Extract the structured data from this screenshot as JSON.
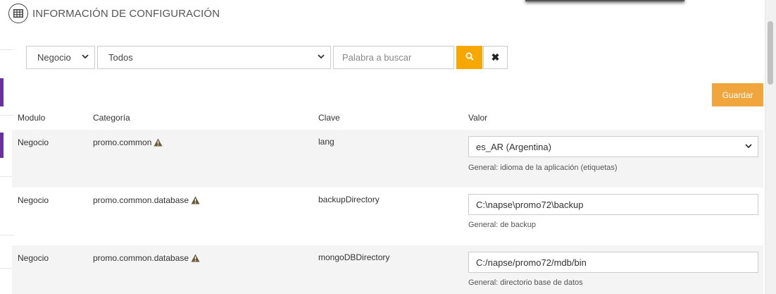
{
  "header": {
    "title": "INFORMACIÓN DE CONFIGURACIÓN",
    "icon": "table-icon"
  },
  "filters": {
    "module_select": {
      "value": "Negocio"
    },
    "category_select": {
      "value": "Todos"
    },
    "search": {
      "placeholder": "Palabra a buscar",
      "value": ""
    },
    "search_icon": "search-icon",
    "clear_label": "✖"
  },
  "toolbar": {
    "save_label": "Guardar"
  },
  "colors": {
    "accent": "#f6a800",
    "save": "#f0a53d",
    "edge": "#6a2fa0",
    "warning": "#6b5a3a"
  },
  "table": {
    "columns": [
      "Modulo",
      "Categoría",
      "Clave",
      "Valor"
    ],
    "rows": [
      {
        "modulo": "Negocio",
        "categoria": "promo.common",
        "warning": true,
        "clave": "lang",
        "valor": "es_AR (Argentina)",
        "valor_type": "select",
        "descripcion": "General: idioma de la aplicación (etiquetas)"
      },
      {
        "modulo": "Negocio",
        "categoria": "promo.common.database",
        "warning": true,
        "clave": "backupDirectory",
        "valor": "C:\\napse\\promo72\\backup",
        "valor_type": "text",
        "descripcion": "General: de backup"
      },
      {
        "modulo": "Negocio",
        "categoria": "promo.common.database",
        "warning": true,
        "clave": "mongoDBDirectory",
        "valor": "C:/napse/promo72/mdb/bin",
        "valor_type": "text",
        "descripcion": "General: directorio base de datos"
      }
    ]
  }
}
